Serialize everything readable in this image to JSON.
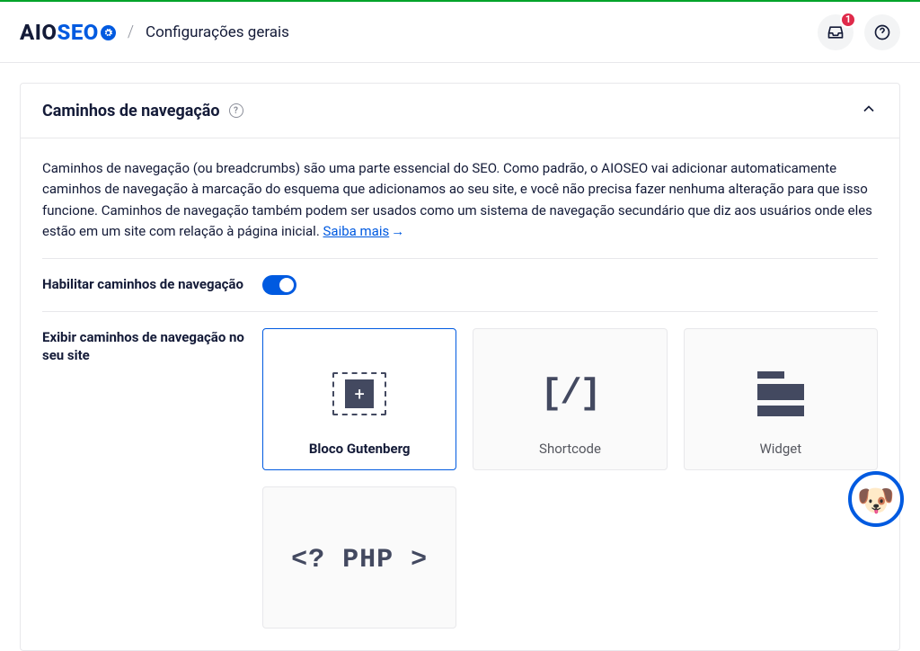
{
  "header": {
    "logo_aio": "AIO",
    "logo_seo": "SEO",
    "breadcrumb_sep": "/",
    "page_title": "Configurações gerais",
    "notification_count": "1"
  },
  "card": {
    "title": "Caminhos de navegação",
    "description_pre": "Caminhos de navegação (ou breadcrumbs) são uma parte essencial do SEO. Como padrão, o AIOSEO vai adicionar automaticamente caminhos de navegação à marcação do esquema que adicionamos ao seu site, e você não precisa fazer nenhuma alteração para que isso funcione. Caminhos de navegação também podem ser usados como um sistema de navegação secundário que diz aos usuários onde eles estão em um site com relação à página inicial. ",
    "learn_more": "Saiba mais",
    "arrow": "→"
  },
  "rows": {
    "enable_label": "Habilitar caminhos de navegação",
    "display_label": "Exibir caminhos de navegação no seu site"
  },
  "options": {
    "gutenberg": "Bloco Gutenberg",
    "shortcode": "Shortcode",
    "widget": "Widget",
    "php": "<? PHP >",
    "php_label": ""
  }
}
